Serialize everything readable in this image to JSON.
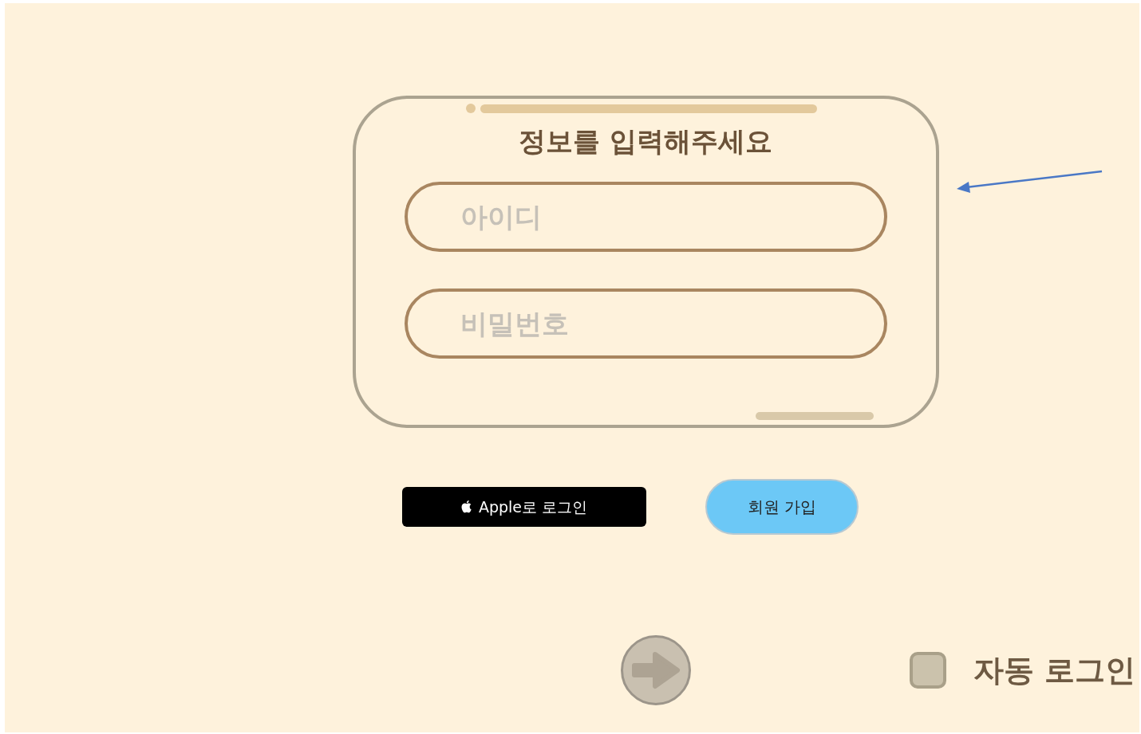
{
  "form": {
    "title": "정보를 입력해주세요",
    "fields": [
      {
        "placeholder": "아이디"
      },
      {
        "placeholder": "비밀번호"
      }
    ]
  },
  "buttons": [
    {
      "kind": "apple",
      "label": "Apple로 로그인"
    },
    {
      "kind": "signup",
      "label": "회원 가입"
    }
  ],
  "next_button": {
    "disabled": true
  },
  "auto_login": {
    "label": "자동 로그인",
    "checked": false
  }
}
